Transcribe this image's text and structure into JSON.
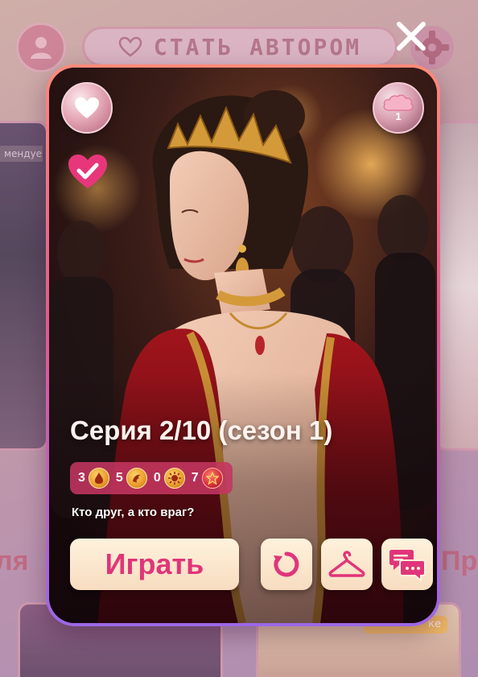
{
  "background": {
    "author_button_label": "СТАТЬ АВТОРОМ",
    "left_card_badge": "мендуе",
    "side_text_left": "ля",
    "side_text_right": "Пр",
    "bottom_right_badge": "ке"
  },
  "episode": {
    "title": "Серия 2/10 (сезон 1)",
    "subtitle": "Кто друг, а кто враг?",
    "currency_count": "1",
    "stats": [
      {
        "value": "3",
        "icon": "drop-coin-icon"
      },
      {
        "value": "5",
        "icon": "dragon-coin-icon"
      },
      {
        "value": "0",
        "icon": "sun-coin-icon"
      },
      {
        "value": "7",
        "icon": "star-coin-icon"
      }
    ]
  },
  "actions": {
    "play_label": "Играть",
    "restart_icon": "restart-icon",
    "wardrobe_icon": "hanger-icon",
    "comments_icon": "chat-icon"
  },
  "colors": {
    "accent_pink": "#e0357a",
    "button_bg": "#fff2dc",
    "stats_bg": "#c43660"
  }
}
